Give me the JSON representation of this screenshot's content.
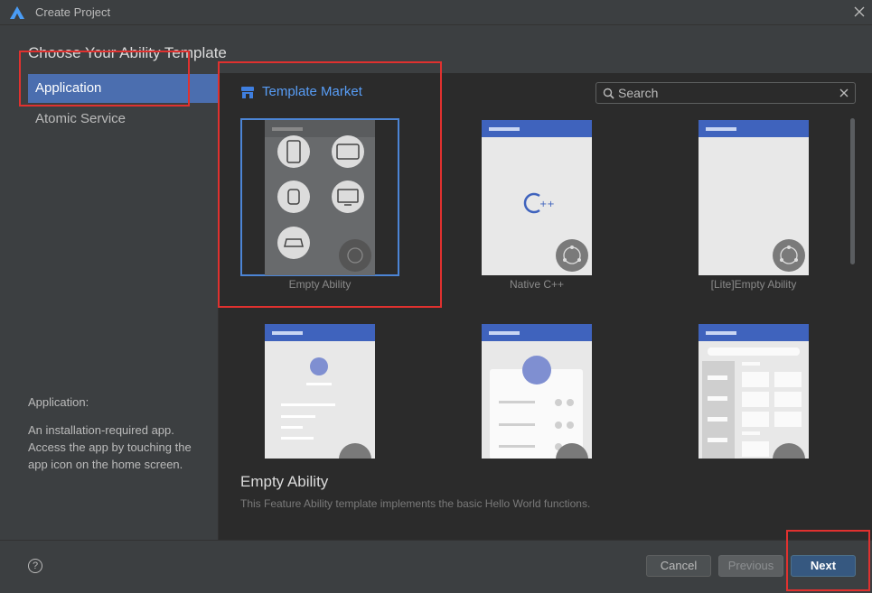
{
  "window": {
    "title": "Create Project"
  },
  "heading": "Choose Your Ability Template",
  "nav": {
    "items": [
      {
        "label": "Application",
        "active": true
      },
      {
        "label": "Atomic Service",
        "active": false
      }
    ],
    "description_title": "Application:",
    "description": "An installation-required app. Access the app by touching the app icon on the home screen."
  },
  "market": {
    "label": "Template Market"
  },
  "search": {
    "placeholder": "Search",
    "value": ""
  },
  "templates": [
    {
      "label": "Empty Ability",
      "selected": true
    },
    {
      "label": "Native C++",
      "selected": false
    },
    {
      "label": "[Lite]Empty Ability",
      "selected": false
    },
    {
      "label": "",
      "selected": false
    },
    {
      "label": "",
      "selected": false
    },
    {
      "label": "",
      "selected": false
    }
  ],
  "detail": {
    "title": "Empty Ability",
    "description": "This Feature Ability template implements the basic Hello World functions."
  },
  "footer": {
    "help": "?",
    "cancel": "Cancel",
    "previous": "Previous",
    "next": "Next"
  },
  "colors": {
    "accent": "#4b6eaf",
    "link": "#589df6",
    "header_bar": "#3f63bd",
    "annotation": "#e0312f"
  }
}
